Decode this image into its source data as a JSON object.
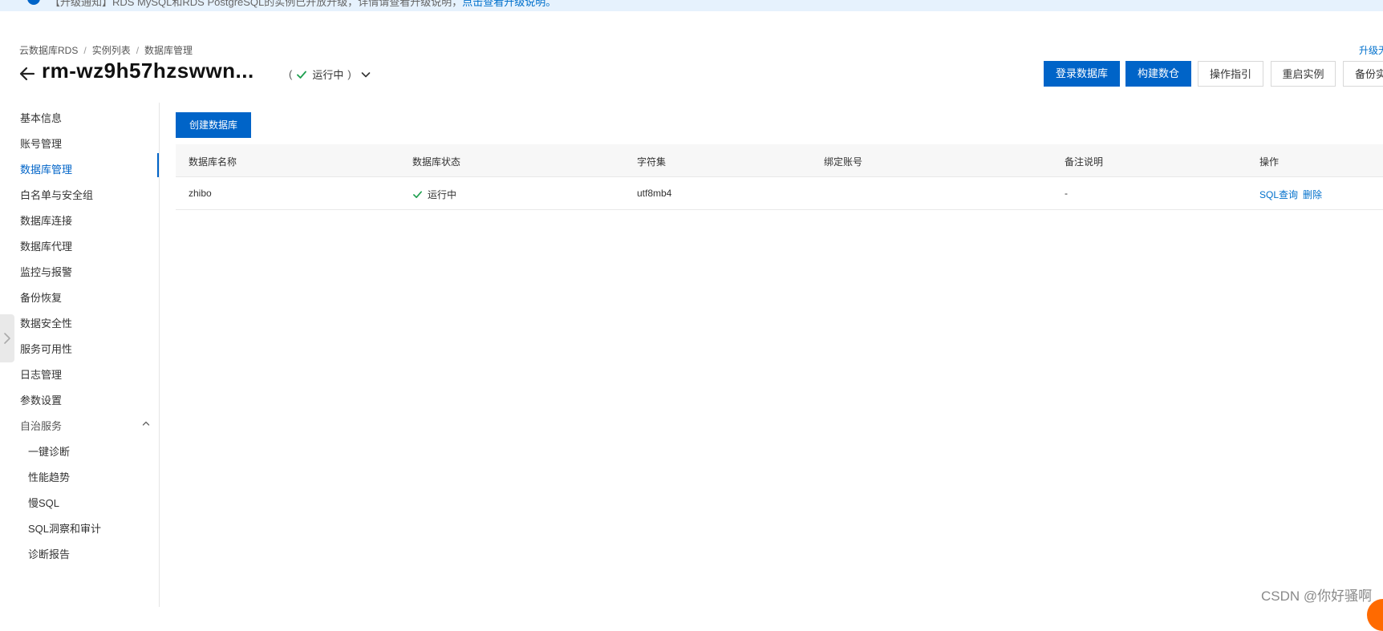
{
  "notice": {
    "text": "【升级通知】RDS MySQL和RDS PostgreSQL的实例已开放升级，详情请查看升级说明，",
    "link": "点击查看升级说明。"
  },
  "breadcrumb": [
    "云数据库RDS",
    "实例列表",
    "数据库管理"
  ],
  "breadcrumb_sep": "/",
  "header": {
    "title": "rm-wz9h57hzswwn...",
    "status_open": "(",
    "status": "运行中",
    "status_close": ")",
    "upgrade_link": "升级无"
  },
  "toolbar": {
    "login_db": "登录数据库",
    "build_warehouse": "构建数仓",
    "guide": "操作指引",
    "restart": "重启实例",
    "backup": "备份实例"
  },
  "sidebar": {
    "items": [
      {
        "label": "基本信息"
      },
      {
        "label": "账号管理"
      },
      {
        "label": "数据库管理",
        "active": true
      },
      {
        "label": "白名单与安全组"
      },
      {
        "label": "数据库连接"
      },
      {
        "label": "数据库代理"
      },
      {
        "label": "监控与报警"
      },
      {
        "label": "备份恢复"
      },
      {
        "label": "数据安全性"
      },
      {
        "label": "服务可用性"
      },
      {
        "label": "日志管理"
      },
      {
        "label": "参数设置"
      }
    ],
    "group": {
      "label": "自治服务",
      "children": [
        {
          "label": "一键诊断"
        },
        {
          "label": "性能趋势"
        },
        {
          "label": "慢SQL"
        },
        {
          "label": "SQL洞察和审计"
        },
        {
          "label": "诊断报告"
        }
      ]
    }
  },
  "main": {
    "create_button": "创建数据库",
    "columns": [
      "数据库名称",
      "数据库状态",
      "字符集",
      "绑定账号",
      "备注说明",
      "操作"
    ],
    "rows": [
      {
        "name": "zhibo",
        "status": "运行中",
        "charset": "utf8mb4",
        "account": "",
        "remark": "-",
        "actions": [
          "SQL查询",
          "删除"
        ]
      }
    ]
  },
  "watermark": "CSDN @你好骚啊",
  "colors": {
    "primary": "#0064c8",
    "link": "#0070cc",
    "success": "#1e9f4f",
    "notice_bg": "#e6f2fd"
  },
  "icons": {
    "back": "arrow-left-icon",
    "status": "check-icon",
    "dropdown": "chevron-down-icon",
    "group_toggle": "chevron-up-icon",
    "collapse": "chevron-right-icon"
  }
}
